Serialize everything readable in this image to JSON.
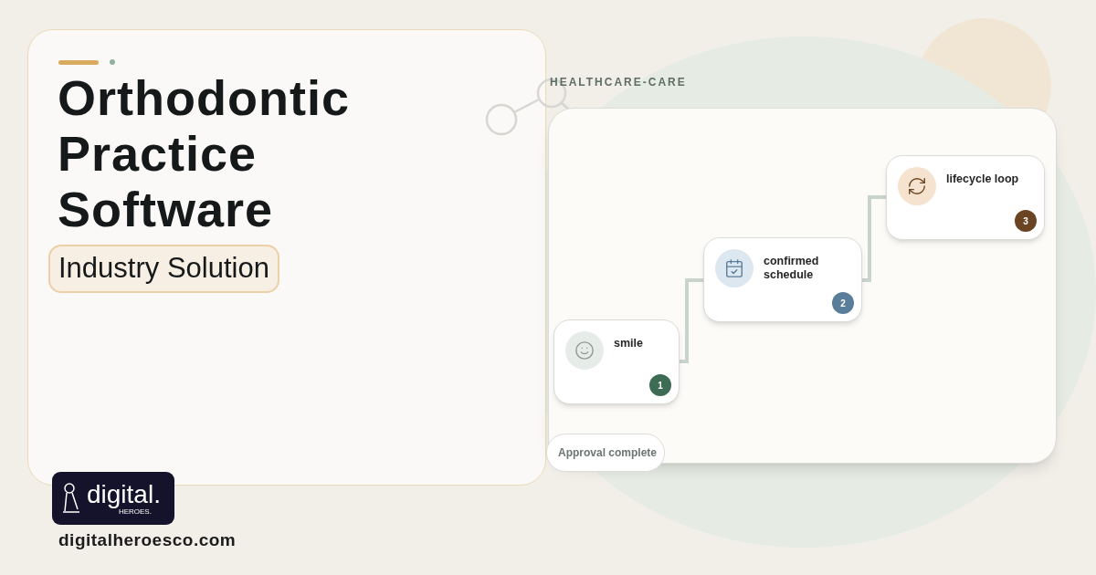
{
  "hero": {
    "title_lines": [
      "Orthodontic",
      "Practice",
      "Software"
    ],
    "tag": "Industry Solution"
  },
  "brand": {
    "logo_word": "digital.",
    "logo_sub": "HEROES.",
    "url": "digitalheroesco.com"
  },
  "diagram": {
    "label": "HEALTHCARE-CARE",
    "steps": [
      {
        "kind": "smile",
        "label": "smile",
        "number": "1",
        "color": "#3d6b54"
      },
      {
        "kind": "calendar",
        "label": "confirmed schedule",
        "number": "2",
        "color": "#5a7d9a"
      },
      {
        "kind": "loop",
        "label": "lifecycle loop",
        "number": "3",
        "color": "#6b4423"
      }
    ],
    "status": "Approval complete"
  }
}
